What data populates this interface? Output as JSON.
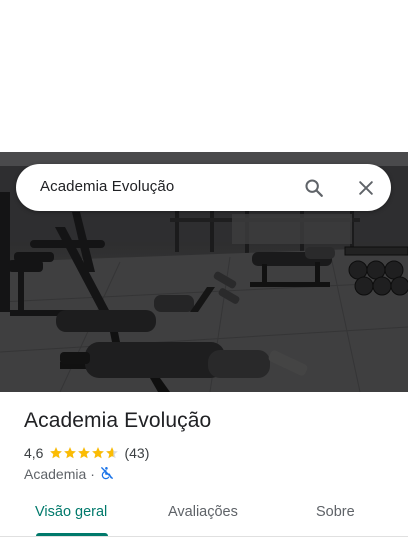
{
  "search": {
    "query": "Academia Evolução",
    "search_icon": "search-icon",
    "close_icon": "close-icon"
  },
  "hero": {
    "description_icon": "gym-photo"
  },
  "place": {
    "title": "Academia Evolução",
    "rating": "4,6",
    "stars": 4.6,
    "review_count": "(43)",
    "category": "Academia",
    "separator": "·",
    "accessibility_icon": "no-wheelchair-access-icon"
  },
  "tabs": [
    {
      "label": "Visão geral",
      "active": true
    },
    {
      "label": "Avaliações",
      "active": false
    },
    {
      "label": "Sobre",
      "active": false
    }
  ],
  "colors": {
    "accent": "#00796b",
    "star": "#fbbc04",
    "wheelchair_icon": "#1a73e8"
  }
}
